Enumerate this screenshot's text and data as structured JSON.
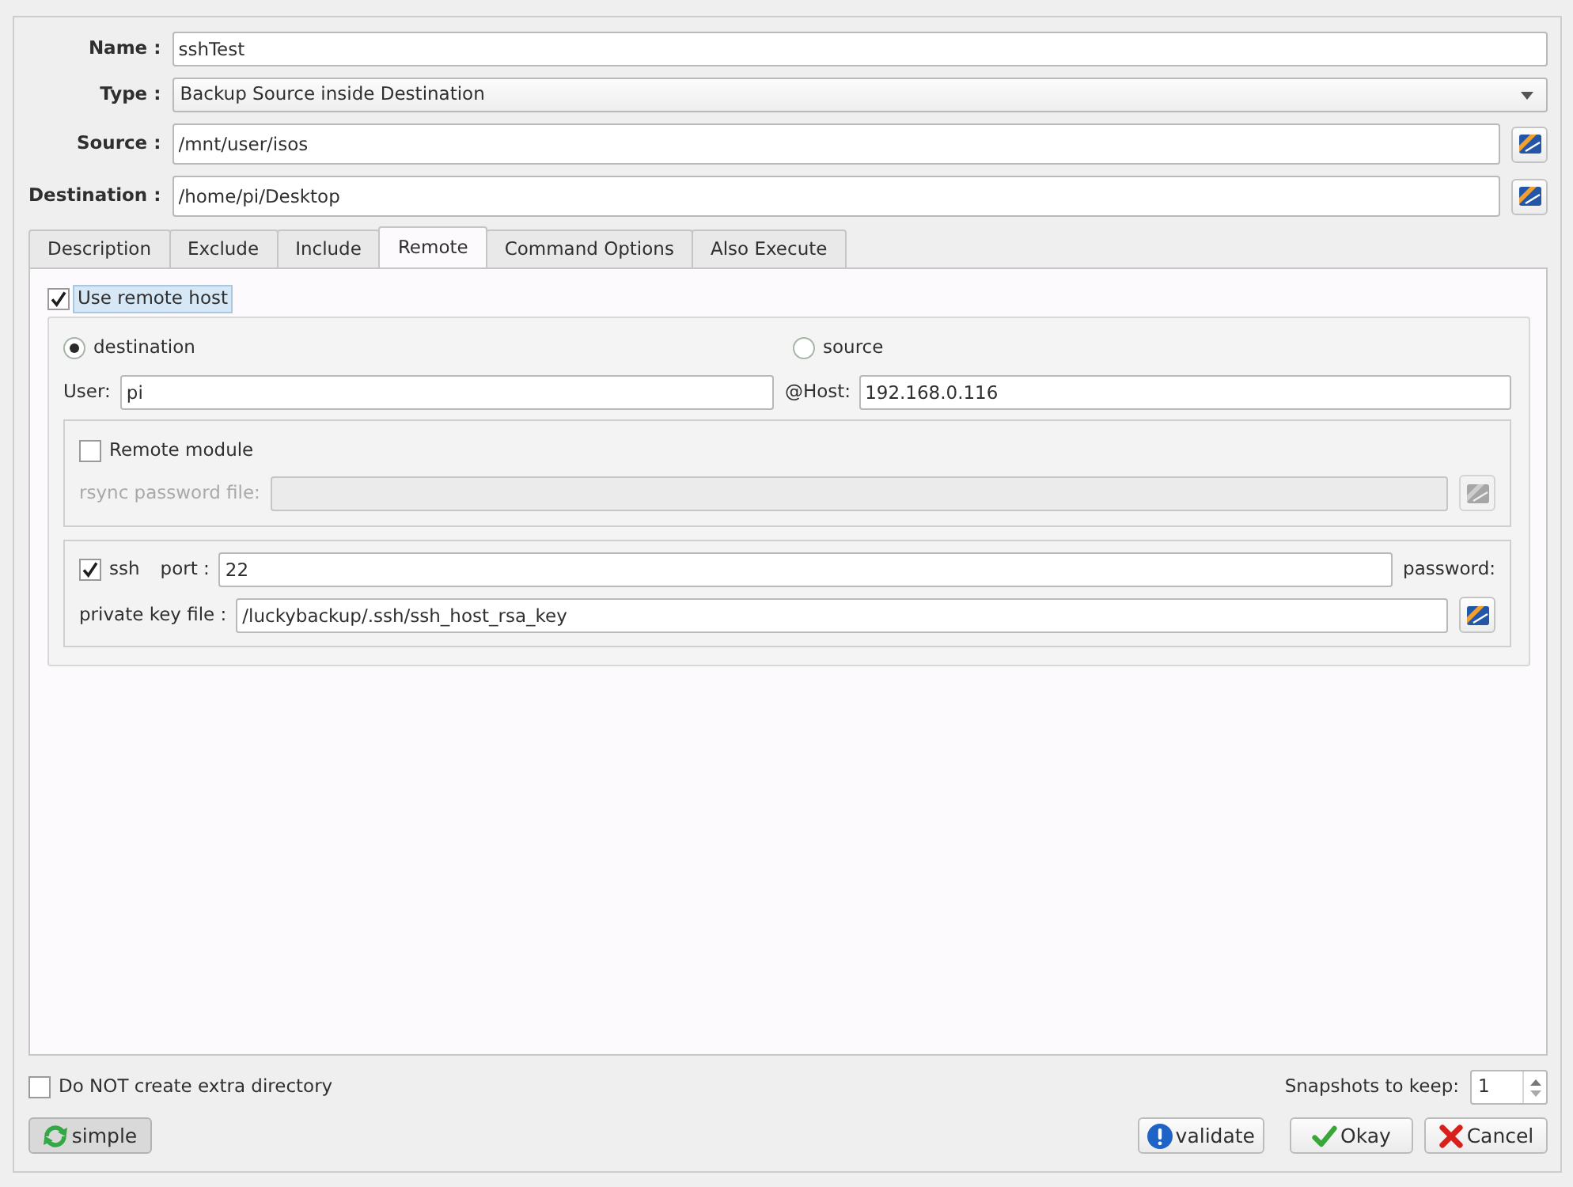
{
  "form": {
    "fields": [
      {
        "kind": "text",
        "label": "Name :",
        "value": "sshTest"
      },
      {
        "kind": "select",
        "label": "Type :",
        "value": "Backup Source inside Destination"
      },
      {
        "kind": "path",
        "label": "Source :",
        "value": "/mnt/user/isos"
      },
      {
        "kind": "path",
        "label": "Destination :",
        "value": "/home/pi/Desktop"
      }
    ]
  },
  "tabs": [
    {
      "label": "Description",
      "selected": false
    },
    {
      "label": "Exclude",
      "selected": false
    },
    {
      "label": "Include",
      "selected": false
    },
    {
      "label": "Remote",
      "selected": true
    },
    {
      "label": "Command Options",
      "selected": false
    },
    {
      "label": "Also Execute",
      "selected": false
    }
  ],
  "remote": {
    "use_remote_host": {
      "label": "Use remote host",
      "checked": true,
      "focused": true
    },
    "direction": [
      {
        "label": "destination",
        "selected": true
      },
      {
        "label": "source",
        "selected": false
      }
    ],
    "user": {
      "label": "User:",
      "value": "pi"
    },
    "host": {
      "label": "@Host:",
      "value": "192.168.0.116"
    },
    "remote_module": {
      "label": "Remote module",
      "checked": false
    },
    "rsync_password_file": {
      "label": "rsync password file:",
      "disabled": true
    },
    "ssh": {
      "label": "ssh",
      "checked": true
    },
    "port": {
      "label": "port :",
      "value": "22"
    },
    "password": {
      "label": "password:"
    },
    "private_key_file": {
      "label": "private key file :",
      "value": "/luckybackup/.ssh/ssh_host_rsa_key"
    }
  },
  "options": {
    "no_extra_directory": {
      "label": "Do NOT create extra directory",
      "checked": false
    },
    "snapshots": {
      "label": "Snapshots to keep:",
      "value": "1"
    }
  },
  "buttons": [
    {
      "kind": "simple",
      "label": "simple"
    },
    {
      "kind": "validate",
      "label": "validate"
    },
    {
      "kind": "okay",
      "label": "Okay"
    },
    {
      "kind": "cancel",
      "label": "Cancel"
    }
  ]
}
